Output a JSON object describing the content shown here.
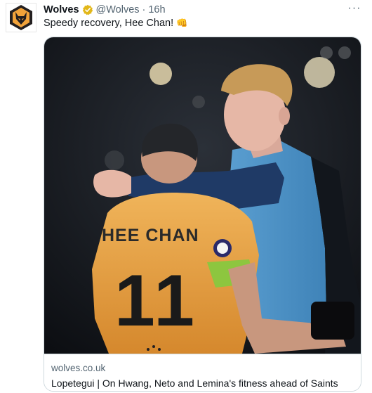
{
  "tweet": {
    "author_name": "Wolves",
    "handle": "@Wolves",
    "separator": "·",
    "time": "16h",
    "text": "Speedy recovery, Hee Chan!",
    "emoji": "👊",
    "more_label": "···"
  },
  "card": {
    "domain": "wolves.co.uk",
    "title": "Lopetegui | On Hwang, Neto and Lemina's fitness ahead of Saints",
    "shirt_name": "HEE CHAN",
    "shirt_number": "11"
  },
  "colors": {
    "brand_gold": "#f2a33a",
    "brand_black": "#231f20",
    "verified_gold": "#e2b719"
  },
  "icons": {
    "avatar": "wolves-crest-icon",
    "verified": "verified-badge-icon",
    "more": "more-horizontal-icon"
  }
}
